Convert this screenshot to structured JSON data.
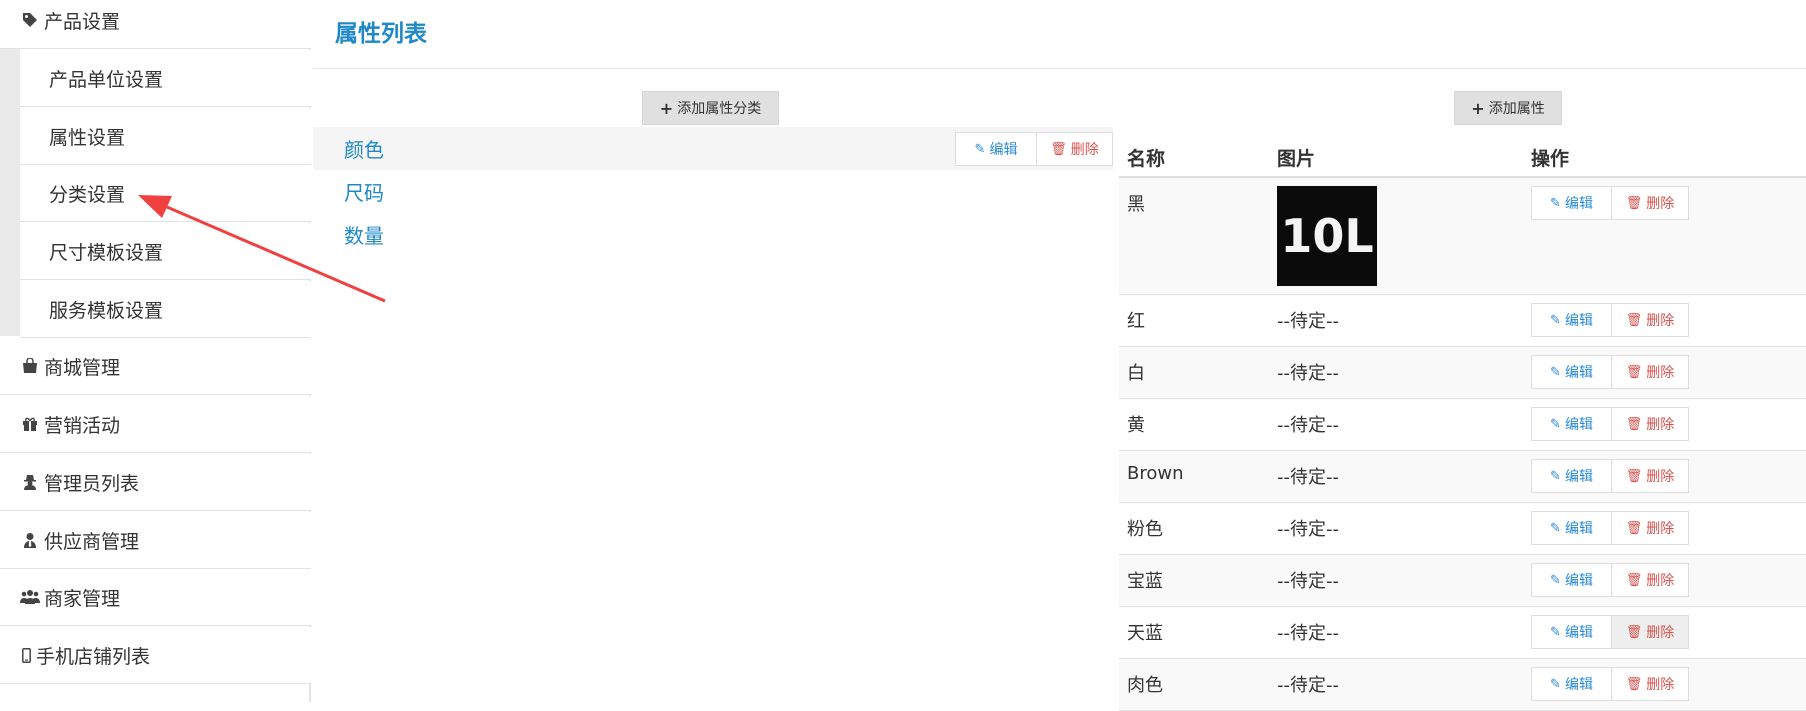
{
  "sidebar": {
    "product_settings": {
      "label": "产品设置",
      "icon": "tag-icon"
    },
    "sub_items": [
      {
        "label": "产品单位设置"
      },
      {
        "label": "属性设置"
      },
      {
        "label": "分类设置"
      },
      {
        "label": "尺寸模板设置"
      },
      {
        "label": "服务模板设置"
      }
    ],
    "items": [
      {
        "label": "商城管理",
        "icon": "shopping-bag-icon"
      },
      {
        "label": "营销活动",
        "icon": "gift-icon"
      },
      {
        "label": "管理员列表",
        "icon": "user-secret-icon"
      },
      {
        "label": "供应商管理",
        "icon": "user-tie-icon"
      },
      {
        "label": "商家管理",
        "icon": "users-icon"
      },
      {
        "label": "手机店铺列表",
        "icon": "mobile-icon"
      }
    ]
  },
  "main": {
    "title": "属性列表",
    "add_category_label": "添加属性分类",
    "add_attribute_label": "添加属性",
    "edit_label": "编辑",
    "delete_label": "删除",
    "categories": [
      {
        "label": "颜色"
      },
      {
        "label": "尺码"
      },
      {
        "label": "数量"
      }
    ],
    "table": {
      "headers": {
        "name": "名称",
        "image": "图片",
        "actions": "操作"
      },
      "thumbnail_text": "10L",
      "rows": [
        {
          "name": "黑",
          "image": ""
        },
        {
          "name": "红",
          "image": "--待定--"
        },
        {
          "name": "白",
          "image": "--待定--"
        },
        {
          "name": "黄",
          "image": "--待定--"
        },
        {
          "name": "Brown",
          "image": "--待定--"
        },
        {
          "name": "粉色",
          "image": "--待定--"
        },
        {
          "name": "宝蓝",
          "image": "--待定--"
        },
        {
          "name": "天蓝",
          "image": "--待定--"
        },
        {
          "name": "肉色",
          "image": "--待定--"
        }
      ]
    }
  },
  "colors": {
    "accent": "#1e88c8",
    "danger": "#d9534f",
    "annotation_arrow": "#f04040"
  }
}
